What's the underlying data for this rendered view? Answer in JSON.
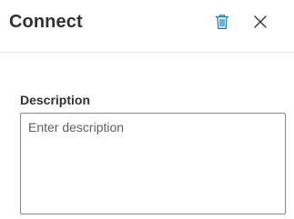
{
  "panel": {
    "title": "Connect",
    "delete_icon": "trash-icon",
    "close_icon": "close-icon"
  },
  "description": {
    "label": "Description",
    "placeholder": "Enter description",
    "value": ""
  },
  "colors": {
    "accent": "#0078d4",
    "text": "#323130",
    "placeholder": "#605e5c",
    "border": "#8a8886",
    "divider": "#edebe9"
  }
}
